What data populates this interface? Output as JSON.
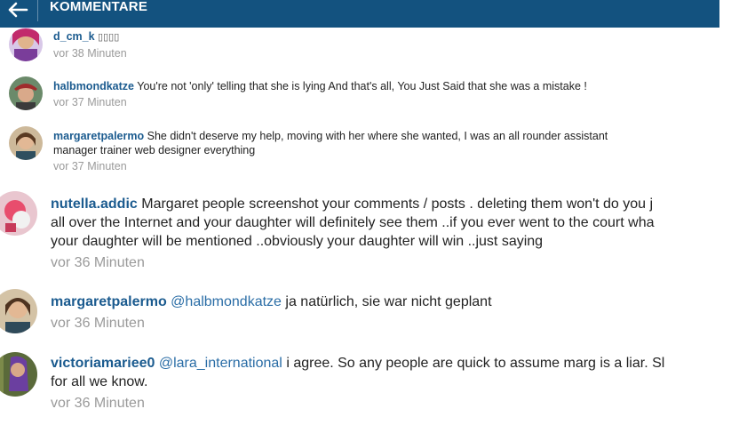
{
  "header": {
    "title": "KOMMENTARE"
  },
  "comments": [
    {
      "user": "d_cm_k",
      "text": "▯▯▯▯",
      "time": "vor 38 Minuten"
    },
    {
      "user": "halbmondkatze",
      "text": "You're not 'only' telling that she is lying And that's all, You Just Said that she was a mistake !",
      "time": "vor 37 Minuten"
    },
    {
      "user": "margaretpalermo",
      "text1": "She didn't deserve my help, moving with her where she wanted, I was an all rounder assistant",
      "text2": "manager trainer web designer everything",
      "time": "vor 37 Minuten"
    },
    {
      "user": "nutella.addic",
      "text1": "Margaret people screenshot your comments / posts . deleting them won't do you j",
      "text2": "all over the Internet and your daughter will definitely see them ..if you ever went to the court wha",
      "text3": "your daughter will be mentioned ..obviously your daughter will win ..just saying",
      "time": "vor 36 Minuten"
    },
    {
      "user": "margaretpalermo",
      "mention": "@halbmondkatze",
      "text": "ja natürlich, sie war nicht geplant",
      "time": "vor 36 Minuten"
    },
    {
      "user": "victoriamariee0",
      "mention": "@lara_international",
      "text1": "i agree. So any people are quick to assume marg is a liar. Sl",
      "text2": "for all we know.",
      "time": "vor 36 Minuten"
    }
  ]
}
